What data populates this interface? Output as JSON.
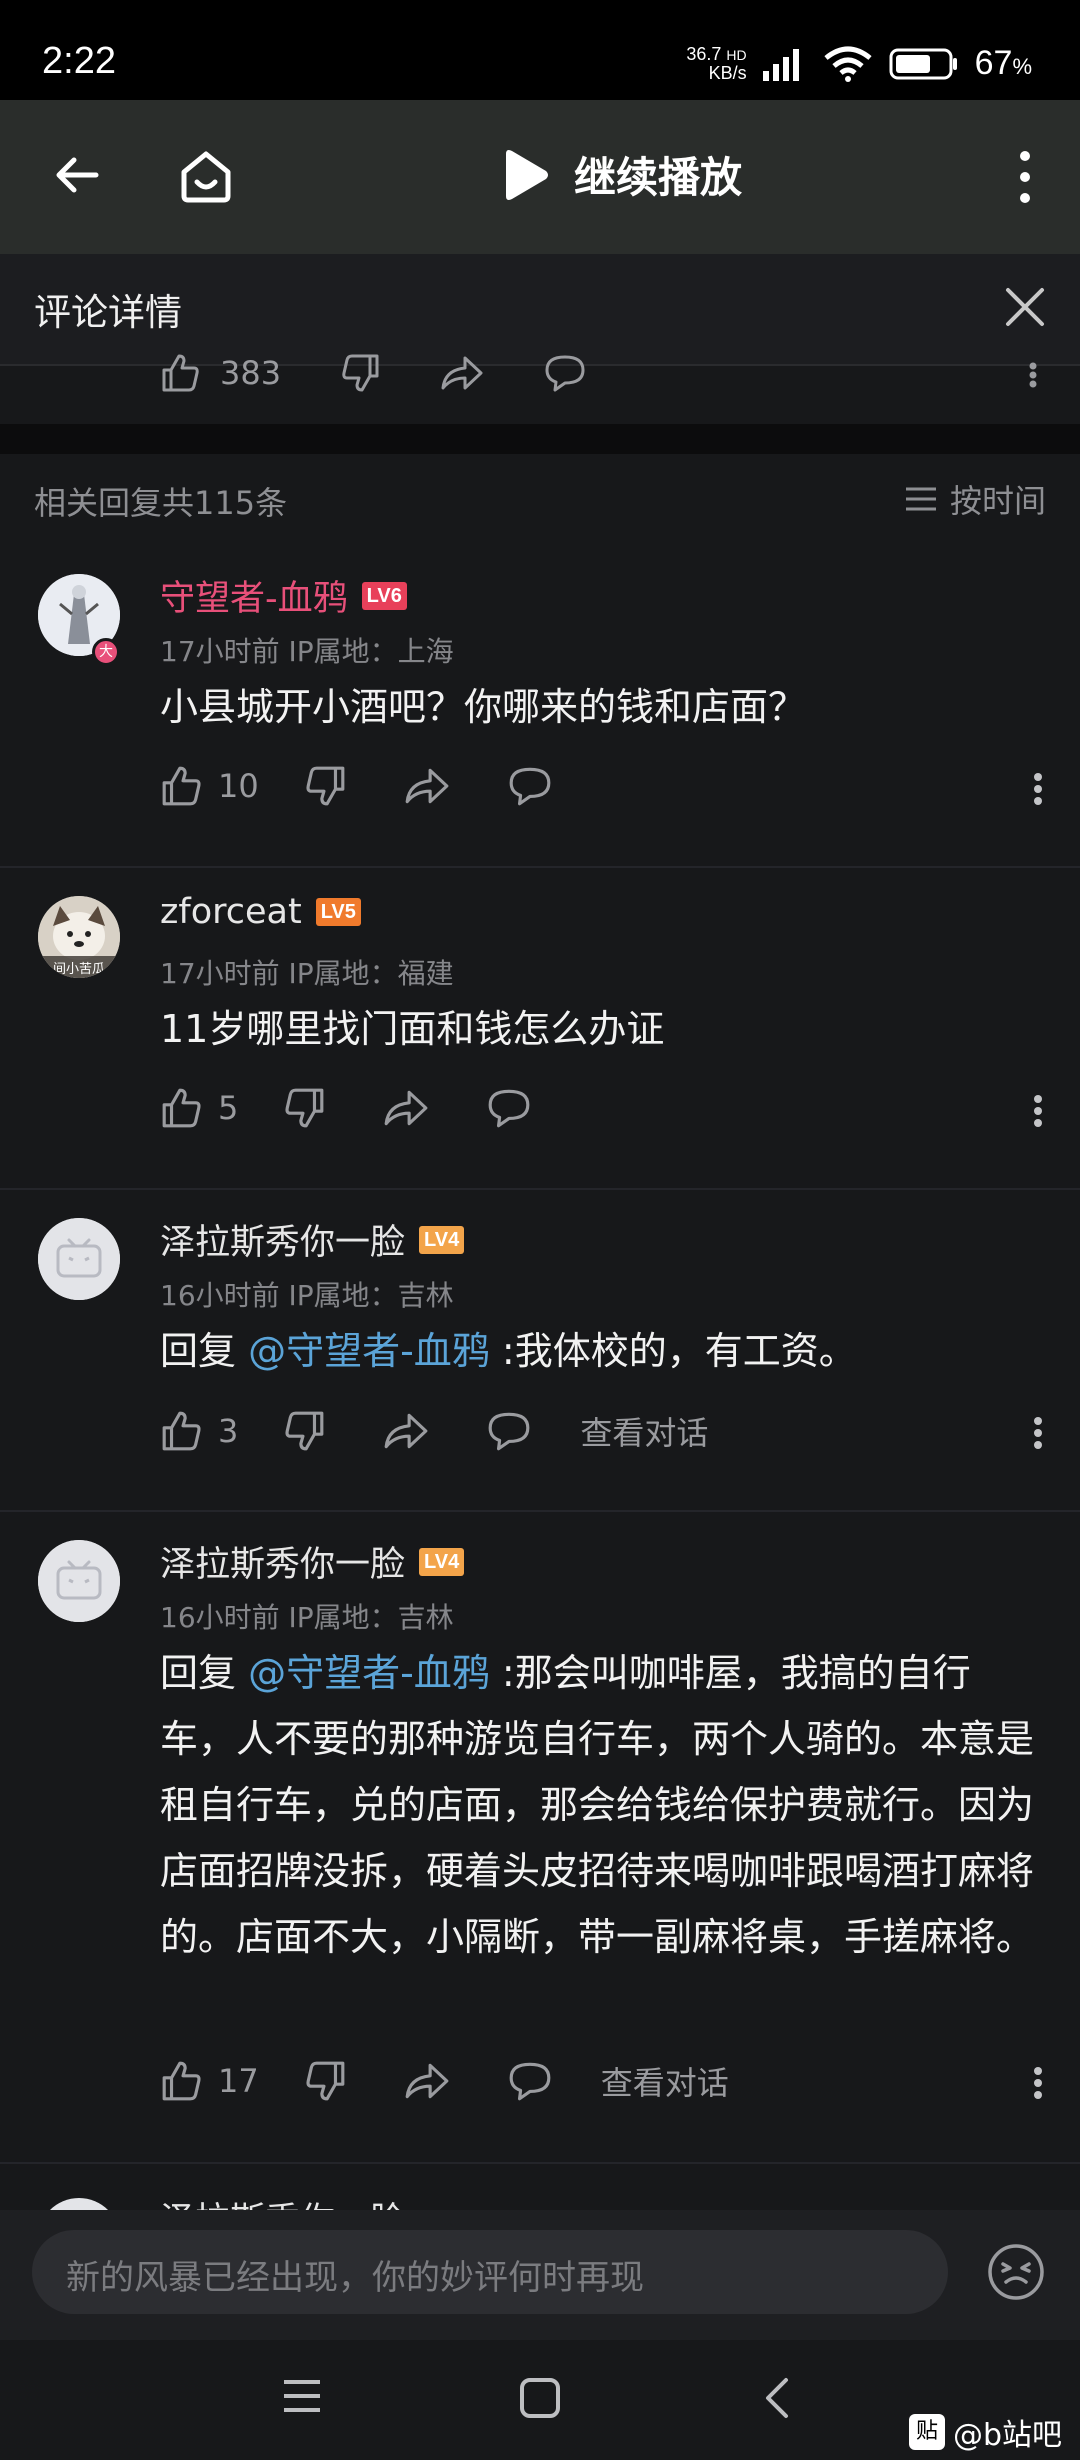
{
  "status_bar": {
    "time": "2:22",
    "net_speed_value": "36.7",
    "net_speed_unit": "KB/s",
    "net_type": "HD",
    "battery": "67",
    "battery_unit": "%"
  },
  "video_bar": {
    "continue_label": "继续播放"
  },
  "sheet": {
    "title": "评论详情",
    "prev_like_count": "383",
    "reply_count_text": "相关回复共115条",
    "sort_label": "按时间"
  },
  "comments": [
    {
      "username": "守望者-血鸦",
      "level": "LV6",
      "meta": "17小时前 IP属地：上海",
      "text": "小县城开小酒吧？你哪来的钱和店面？",
      "likes": "10"
    },
    {
      "username": "zforceat",
      "level": "LV5",
      "avatar_caption": "间小苦瓜",
      "meta": "17小时前 IP属地：福建",
      "text": "11岁哪里找门面和钱怎么办证",
      "likes": "5"
    },
    {
      "username": "泽拉斯秀你一脸",
      "level": "LV4",
      "meta": "16小时前 IP属地：吉林",
      "reply_prefix": "回复 ",
      "mention": "@守望者-血鸦",
      "text": " :我体校的，有工资。",
      "likes": "3",
      "view_dialog": "查看对话"
    },
    {
      "username": "泽拉斯秀你一脸",
      "level": "LV4",
      "meta": "16小时前 IP属地：吉林",
      "reply_prefix": "回复 ",
      "mention": "@守望者-血鸦",
      "text_line1": " :那会叫咖啡屋，我搞的自行",
      "text_rest": "车，人不要的那种游览自行车，两个人骑的。本意是租自行车，兑的店面，那会给钱给保护费就行。因为店面招牌没拆，硬着头皮招待来喝咖啡跟喝酒打麻将的。店面不大，小隔断，带一副麻将桌，手搓麻将。",
      "likes": "17",
      "view_dialog": "查看对话"
    }
  ],
  "partial_next_username": "泽拉斯秀你一脸",
  "input": {
    "placeholder": "新的风暴已经出现，你的妙评何时再现"
  },
  "watermark": {
    "logo": "贴",
    "text": "@b站吧"
  },
  "colors": {
    "username_vip": "#e8507a",
    "mention": "#5ba4d8",
    "lv6": "#e8405a",
    "lv5": "#f07a2c",
    "lv4": "#f3a44a"
  }
}
